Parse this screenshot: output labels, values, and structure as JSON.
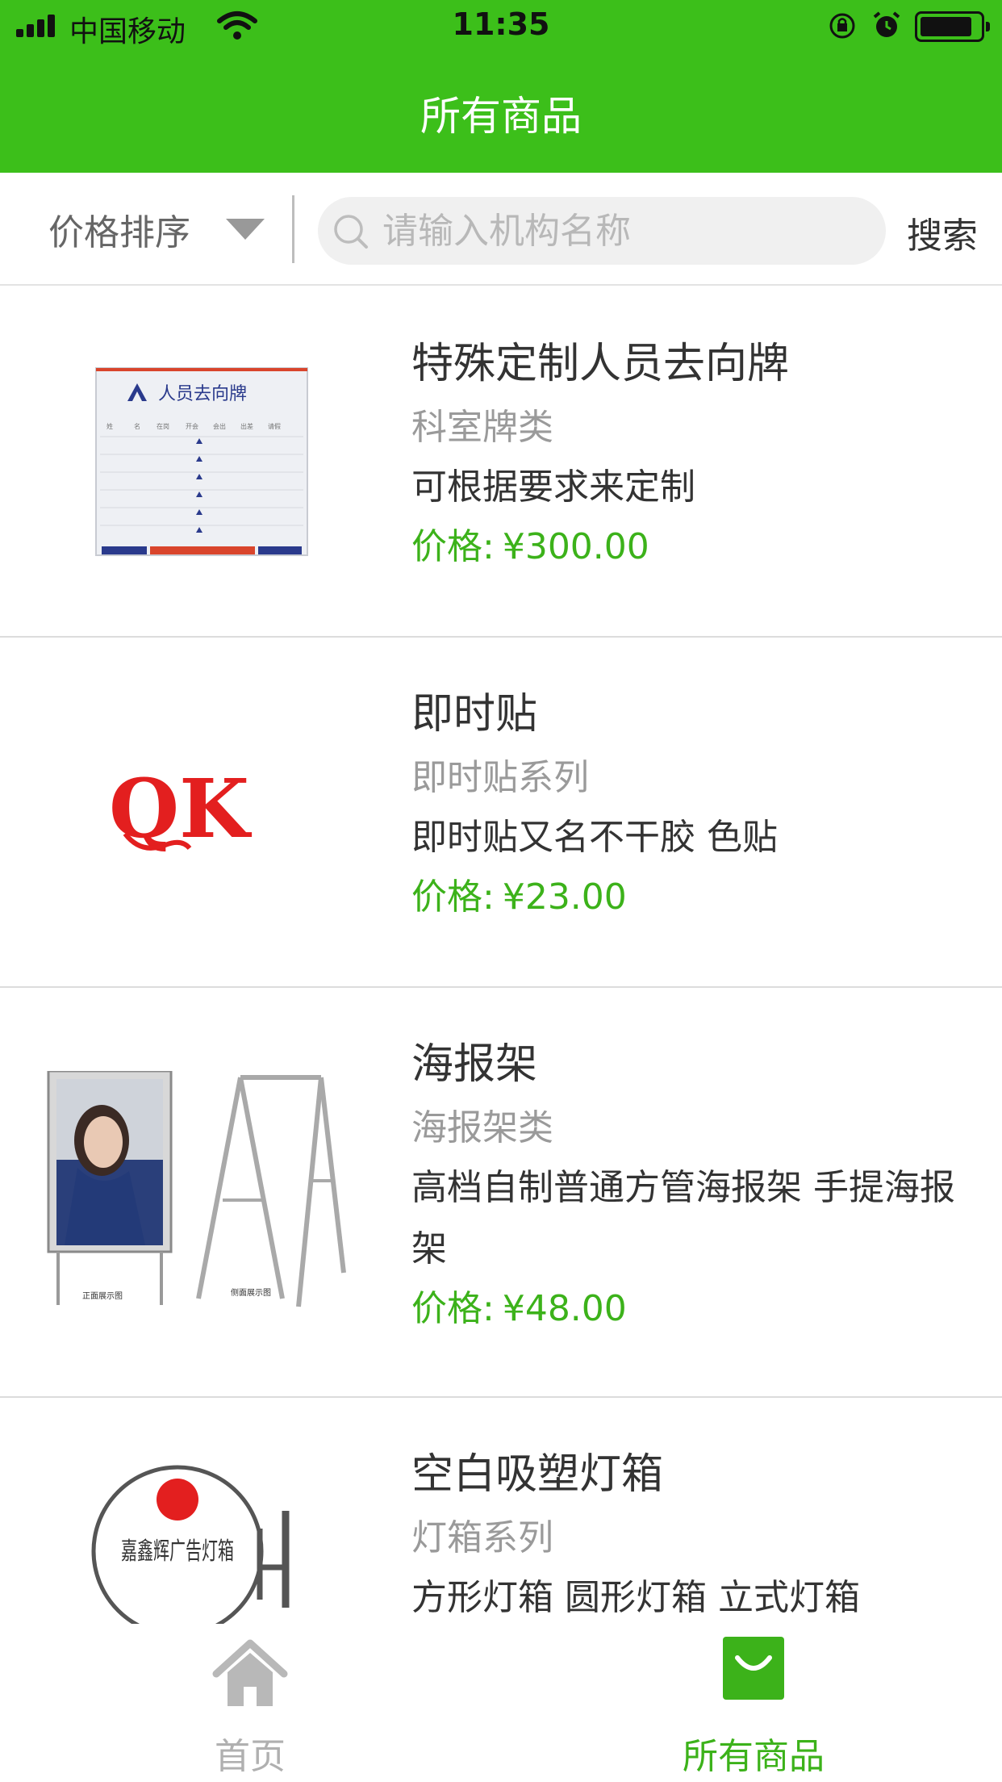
{
  "status_bar": {
    "carrier": "中国移动",
    "time": "11:35",
    "battery_level": 0.85
  },
  "header": {
    "title": "所有商品"
  },
  "filter": {
    "sort_label": "价格排序",
    "search_placeholder": "请输入机构名称",
    "search_button": "搜索"
  },
  "products": [
    {
      "name": "特殊定制人员去向牌",
      "category": "科室牌类",
      "description": "可根据要求来定制",
      "price_label": "价格:",
      "price": "¥300.00",
      "image_text": "人员去向牌",
      "image_columns": [
        "姓",
        "名",
        "在岗",
        "开会",
        "会出",
        "出差",
        "请假"
      ]
    },
    {
      "name": "即时贴",
      "category": "即时贴系列",
      "description": "即时贴又名不干胶 色贴",
      "price_label": "价格:",
      "price": "¥23.00",
      "image_text": "QK"
    },
    {
      "name": "海报架",
      "category": "海报架类",
      "description": "高档自制普通方管海报架 手提海报架",
      "price_label": "价格:",
      "price": "¥48.00",
      "image_captions": [
        "正面展示图",
        "侧面展示图"
      ]
    },
    {
      "name": "空白吸塑灯箱",
      "category": "灯箱系列",
      "description": "方形灯箱 圆形灯箱 立式灯箱",
      "image_text": "嘉鑫辉广告灯箱"
    }
  ],
  "tabbar": {
    "tabs": [
      {
        "label": "首页",
        "icon": "home-icon",
        "active": false
      },
      {
        "label": "所有商品",
        "icon": "shopping-bag-icon",
        "active": true
      }
    ]
  },
  "colors": {
    "brand_green": "#3cbf1a",
    "price_green": "#3cb21a",
    "muted_text": "#9a9a9a"
  }
}
